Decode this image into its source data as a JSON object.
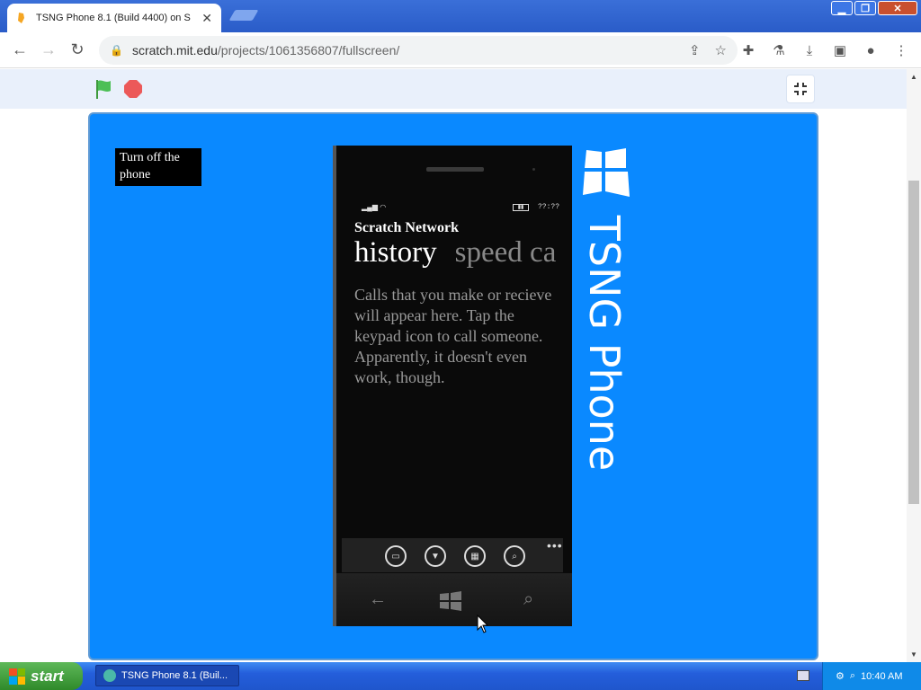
{
  "browser": {
    "tab_title": "TSNG Phone 8.1 (Build 4400) on Sc",
    "url_domain": "scratch.mit.edu",
    "url_path": "/projects/1061356807/fullscreen/"
  },
  "stage": {
    "notice": "Turn off the phone",
    "background_color": "#0a89ff"
  },
  "phone": {
    "time": "??:??",
    "app_title": "Scratch Network",
    "pivot_active": "history",
    "pivot_next": "speed ca",
    "message": "Calls that you make or recieve will appear here. Tap the keypad icon to call someone. Apparently, it doesn't even work, though.",
    "more": "•••"
  },
  "brand": {
    "text": "TSNG Phone"
  },
  "taskbar": {
    "start_label": "start",
    "task_label": "TSNG Phone 8.1 (Buil...",
    "clock": "10:40 AM"
  }
}
